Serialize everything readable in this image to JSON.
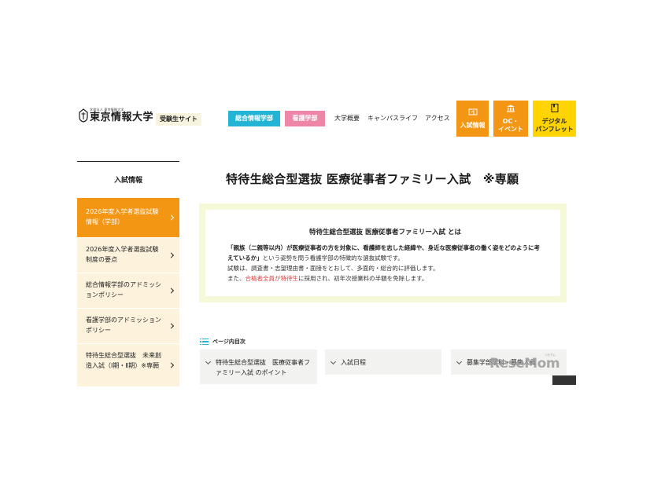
{
  "header": {
    "logo_sub": "学校法人 東京情報大学",
    "logo_main": "東京情報大学",
    "exam_site": "受験生サイト",
    "nav_buttons": [
      "総合情報学部",
      "看護学部"
    ],
    "nav_links": [
      "大学概要",
      "キャンパスライフ",
      "アクセス"
    ],
    "tiles": {
      "nyushi": "入試情報",
      "oc": [
        "OC・",
        "イベント"
      ],
      "pamphlet": [
        "デジタル",
        "パンフレット"
      ]
    }
  },
  "sidebar": {
    "title": "入試情報",
    "items": [
      {
        "label": "2026年度入学者選抜試験情報（学部）"
      },
      {
        "label": "2026年度入学者選抜試験制度の要点"
      },
      {
        "label": "総合情報学部のアドミッションポリシー"
      },
      {
        "label": "看護学部のアドミッションポリシー"
      },
      {
        "label": "特待生総合型選抜　未来創造入試（Ⅰ期・Ⅱ期）※専願"
      }
    ]
  },
  "main": {
    "title": "特待生総合型選抜 医療従事者ファミリー入試　※専願",
    "intro": {
      "heading": "特待生総合型選抜 医療従事者ファミリー入試 とは",
      "p1_bold": "「親族（二親等以内）が医療従事者の方を対象に、看護師を志した経緯や、身近な医療従事者の働く姿をどのように考えているか」",
      "p1_rest": "という姿勢を問う看護学部の特徴的な選抜試験です。",
      "p2": "試験は、調査書・志望理由書・面接をとおして、多面的・総合的に評価します。",
      "p3_a": "また、",
      "p3_red": "合格者全員が特待生",
      "p3_b": "に採用され、初年次授業料の半額を免除します。"
    },
    "toc_label": "ページ内目次",
    "toc": [
      {
        "label": "特待生総合型選抜　医療従事者ファミリー入試 のポイント"
      },
      {
        "label": "入試日程"
      },
      {
        "label": "募集学部学科・募集人員"
      }
    ]
  },
  "watermark": {
    "text": "ReseMom",
    "kana": "リセマム"
  }
}
